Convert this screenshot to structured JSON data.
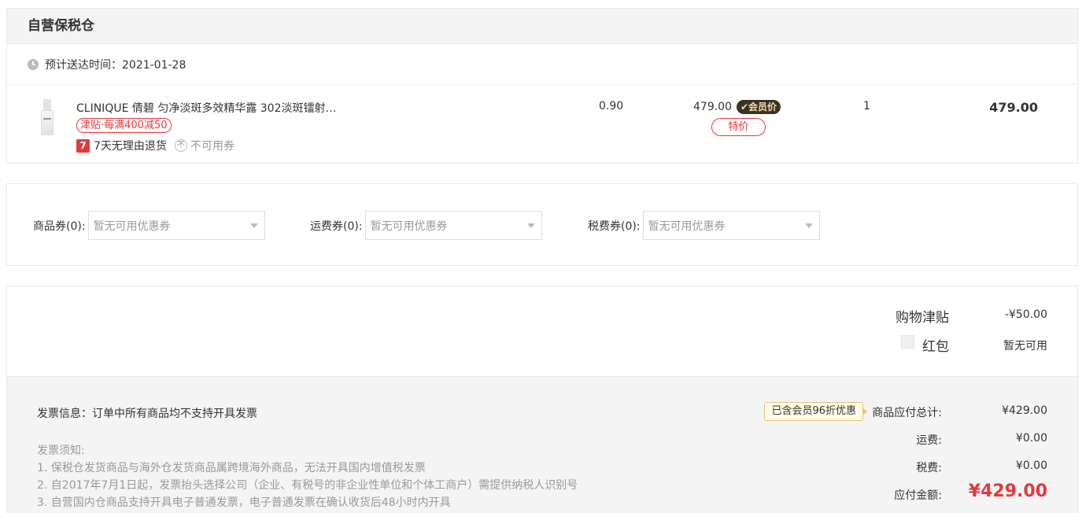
{
  "warehouse": {
    "title": "自营保税仓",
    "delivery": "预计送达时间：2021-01-28",
    "item": {
      "name": "CLINIQUE 倩碧 匀净淡斑多效精华露 302淡斑镭射…",
      "promo": "津贴·每满400减50",
      "return_badge": "7",
      "return_text": "7天无理由退货",
      "no_coupon_icon": "不",
      "no_coupon_text": "不可用券",
      "discount": "0.90",
      "unit_price": "479.00",
      "vip_badge": "✔会员价",
      "special_tag": "特价",
      "qty": "1",
      "subtotal": "479.00"
    }
  },
  "coupons": [
    {
      "label": "商品券(0):",
      "placeholder": "暂无可用优惠券"
    },
    {
      "label": "运费券(0):",
      "placeholder": "暂无可用优惠券"
    },
    {
      "label": "税费券(0):",
      "placeholder": "暂无可用优惠券"
    }
  ],
  "summary": {
    "jintie_label": "购物津贴",
    "jintie_value": "-¥50.00",
    "hongbao_label": "红包",
    "hongbao_value": "暂无可用",
    "invoice_info": "发票信息：订单中所有商品均不支持开具发票",
    "notes_title": "发票须知:",
    "notes": [
      "1. 保税仓发货商品与海外仓发货商品属跨境海外商品，无法开具国内增值税发票",
      "2. 自2017年7月1日起，发票抬头选择公司（企业、有税号的非企业性单位和个体工商户）需提供纳税人识别号",
      "3. 自营国内仓商品支持开具电子普通发票，电子普通发票在确认收货后48小时内开具"
    ],
    "member_tip": "已含会员96折优惠",
    "goods_total_label": "商品应付总计:",
    "goods_total_value": "¥429.00",
    "shipping_label": "运费:",
    "shipping_value": "¥0.00",
    "tax_label": "税费:",
    "tax_value": "¥0.00",
    "pay_label": "应付金额:",
    "pay_value": "¥429.00"
  }
}
